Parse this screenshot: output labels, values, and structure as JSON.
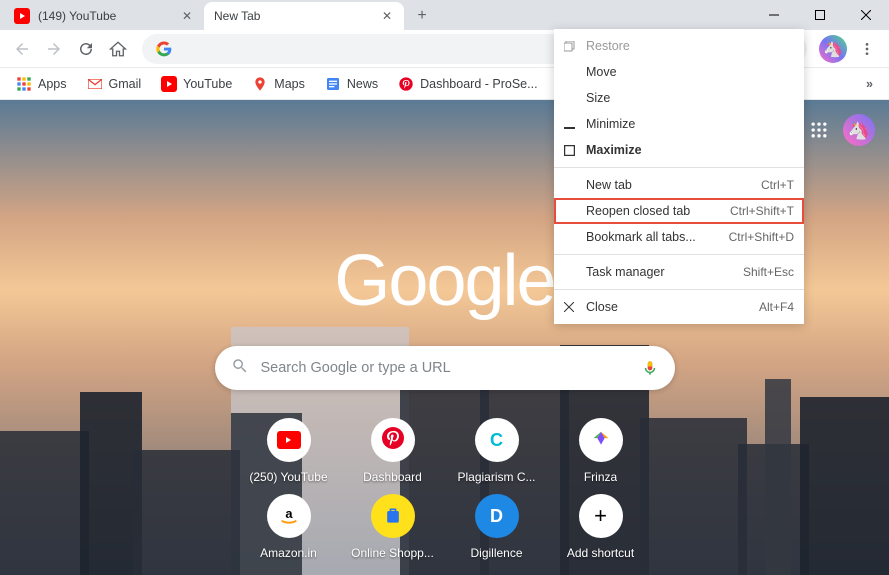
{
  "tabs": [
    {
      "title": "(149) YouTube",
      "active": false
    },
    {
      "title": "New Tab",
      "active": true
    }
  ],
  "bookmarks_bar": {
    "apps_label": "Apps",
    "items": [
      {
        "name": "Gmail"
      },
      {
        "name": "YouTube"
      },
      {
        "name": "Maps"
      },
      {
        "name": "News"
      },
      {
        "name": "Dashboard - ProSe..."
      }
    ]
  },
  "ntp": {
    "logo": "Google",
    "search_placeholder": "Search Google or type a URL",
    "shortcuts": [
      {
        "label": "(250) YouTube"
      },
      {
        "label": "Dashboard"
      },
      {
        "label": "Plagiarism C..."
      },
      {
        "label": "Frinza"
      },
      {
        "label": "Amazon.in"
      },
      {
        "label": "Online Shopp..."
      },
      {
        "label": "Digillence"
      },
      {
        "label": "Add shortcut"
      }
    ]
  },
  "context_menu": {
    "items": [
      {
        "label": "Restore",
        "shortcut": "",
        "disabled": true,
        "icon": "restore",
        "separator_after": false
      },
      {
        "label": "Move",
        "shortcut": "",
        "disabled": false,
        "separator_after": false
      },
      {
        "label": "Size",
        "shortcut": "",
        "disabled": false,
        "separator_after": false
      },
      {
        "label": "Minimize",
        "shortcut": "",
        "disabled": false,
        "icon": "minimize",
        "separator_after": false
      },
      {
        "label": "Maximize",
        "shortcut": "",
        "disabled": false,
        "icon": "maximize",
        "bold": true,
        "separator_after": true
      },
      {
        "label": "New tab",
        "shortcut": "Ctrl+T",
        "disabled": false,
        "separator_after": false
      },
      {
        "label": "Reopen closed tab",
        "shortcut": "Ctrl+Shift+T",
        "disabled": false,
        "highlighted": true,
        "separator_after": false
      },
      {
        "label": "Bookmark all tabs...",
        "shortcut": "Ctrl+Shift+D",
        "disabled": false,
        "separator_after": true
      },
      {
        "label": "Task manager",
        "shortcut": "Shift+Esc",
        "disabled": false,
        "separator_after": true
      },
      {
        "label": "Close",
        "shortcut": "Alt+F4",
        "disabled": false,
        "icon": "close",
        "separator_after": false
      }
    ]
  }
}
